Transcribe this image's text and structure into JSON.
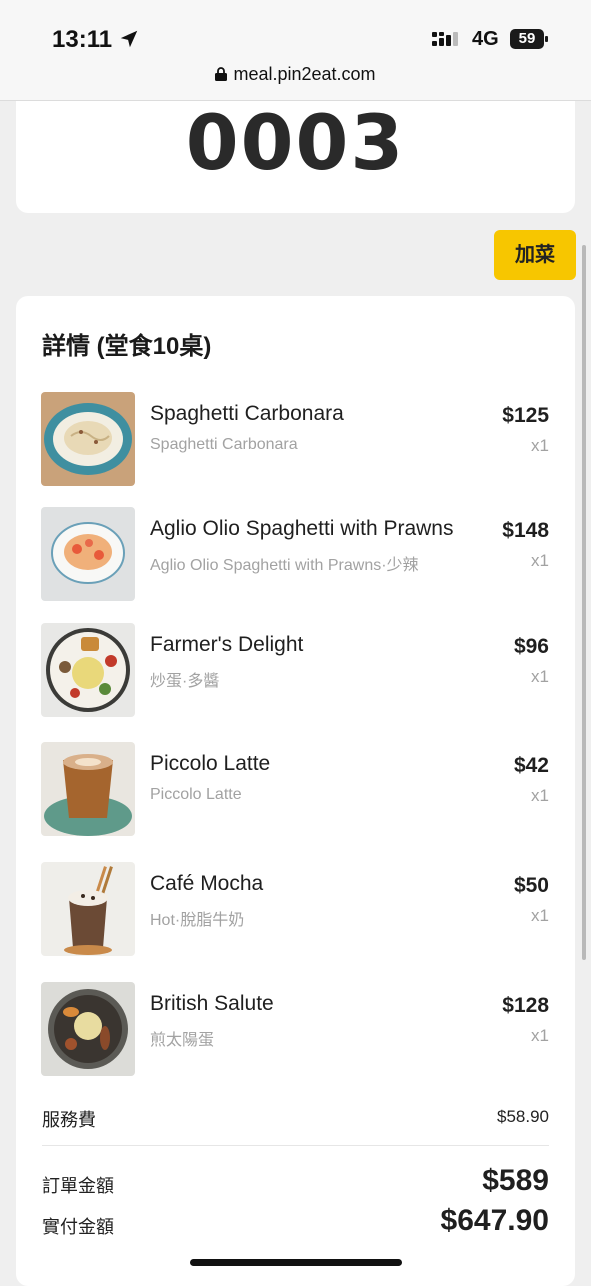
{
  "status_bar": {
    "time": "13:11",
    "network": "4G",
    "battery": "59"
  },
  "browser": {
    "url": "meal.pin2eat.com"
  },
  "queue": {
    "number": "0003"
  },
  "add_button": {
    "label": "加菜"
  },
  "details": {
    "title": "詳情 (堂食10桌)",
    "items": [
      {
        "name": "Spaghetti Carbonara",
        "sub": "Spaghetti Carbonara",
        "price": "$125",
        "qty": "x1"
      },
      {
        "name": "Aglio Olio Spaghetti with Prawns",
        "sub": "Aglio Olio Spaghetti with Prawns·少辣",
        "price": "$148",
        "qty": "x1"
      },
      {
        "name": "Farmer's Delight",
        "sub": "炒蛋·多醬",
        "price": "$96",
        "qty": "x1"
      },
      {
        "name": "Piccolo Latte",
        "sub": "Piccolo Latte",
        "price": "$42",
        "qty": "x1"
      },
      {
        "name": "Café Mocha",
        "sub": "Hot·脫脂牛奶",
        "price": "$50",
        "qty": "x1"
      },
      {
        "name": "British Salute",
        "sub": "煎太陽蛋",
        "price": "$128",
        "qty": "x1"
      }
    ],
    "service_charge": {
      "label": "服務費",
      "value": "$58.90"
    },
    "order_total": {
      "label": "訂單金額",
      "value": "$589"
    },
    "paid_total": {
      "label": "實付金額",
      "value": "$647.90"
    }
  },
  "colors": {
    "accent": "#f7c600",
    "background": "#efefef",
    "card": "#ffffff"
  }
}
